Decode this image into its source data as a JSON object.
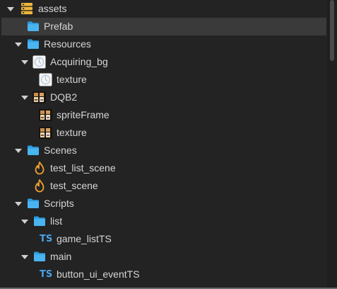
{
  "tree": {
    "items": [
      {
        "label": "assets",
        "icon": "database-icon"
      },
      {
        "label": "Prefab",
        "icon": "folder-icon"
      },
      {
        "label": "Resources",
        "icon": "folder-icon"
      },
      {
        "label": "Acquiring_bg",
        "icon": "image-icon"
      },
      {
        "label": "texture",
        "icon": "image-icon"
      },
      {
        "label": "DQB2",
        "icon": "sprite-thumbnail-icon"
      },
      {
        "label": "spriteFrame",
        "icon": "sprite-thumbnail-icon"
      },
      {
        "label": "texture",
        "icon": "sprite-thumbnail-icon"
      },
      {
        "label": "Scenes",
        "icon": "folder-icon"
      },
      {
        "label": "test_list_scene",
        "icon": "scene-flame-icon"
      },
      {
        "label": "test_scene",
        "icon": "scene-flame-icon"
      },
      {
        "label": "Scripts",
        "icon": "folder-icon"
      },
      {
        "label": "list",
        "icon": "folder-icon"
      },
      {
        "label": "game_listTS",
        "icon": "typescript-icon"
      },
      {
        "label": "main",
        "icon": "folder-icon"
      },
      {
        "label": "button_ui_eventTS",
        "icon": "typescript-icon"
      }
    ],
    "ts_badge": "TS"
  },
  "colors": {
    "background": "#232323",
    "selected_row": "#3a3a3a",
    "folder": "#2d9de0",
    "database": "#f0b63c",
    "flame": "#f0a030",
    "typescript": "#4aa3e8",
    "text": "#d6d6d6"
  }
}
